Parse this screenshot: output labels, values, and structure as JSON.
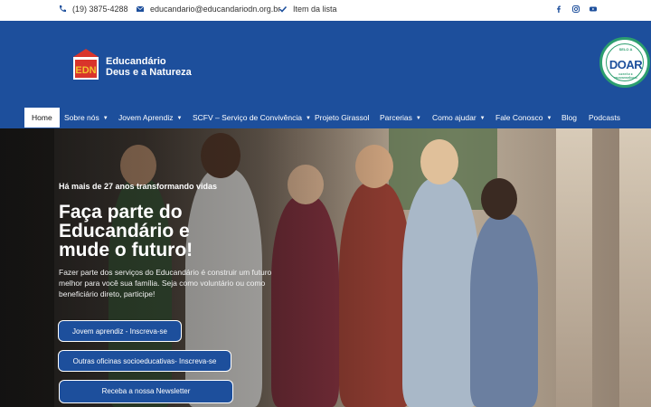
{
  "topbar": {
    "phone": "(19) 3875-4288",
    "email": "educandario@educandariodn.org.br",
    "list_link": "Item da lista",
    "social": [
      "facebook-icon",
      "instagram-icon",
      "youtube-icon"
    ]
  },
  "header": {
    "logo_line1": "Educandário",
    "logo_line2": "Deus e a Natureza",
    "seal_top": "SELO A",
    "seal_word": "DOAR",
    "seal_bottom": "GESTÃO E TRANSPARÊNCIA"
  },
  "nav": {
    "items": [
      {
        "label": "Home",
        "dropdown": false
      },
      {
        "label": "Sobre nós",
        "dropdown": true
      },
      {
        "label": "Jovem Aprendiz",
        "dropdown": true
      },
      {
        "label": "SCFV – Serviço de Convivência",
        "dropdown": true
      },
      {
        "label": "Projeto Girassol",
        "dropdown": false
      },
      {
        "label": "Parcerias",
        "dropdown": true
      },
      {
        "label": "Como ajudar",
        "dropdown": true
      },
      {
        "label": "Fale Conosco",
        "dropdown": true
      },
      {
        "label": "Blog",
        "dropdown": false
      },
      {
        "label": "Podcasts",
        "dropdown": false
      }
    ]
  },
  "hero": {
    "eyebrow": "Há mais de 27 anos transformando vidas",
    "headline_line1": "Faça parte do",
    "headline_line2": "Educandário e",
    "headline_line3": "mude o futuro!",
    "lead": "Fazer parte dos serviços do Educandário é construir um futuro melhor para você sua família. Seja como voluntário ou como beneficiário direto, participe!",
    "buttons": [
      "Jovem aprendiz - Inscreva-se",
      "Outras oficinas socioeducativas- Inscreva-se",
      "Receba a nossa Newsletter"
    ]
  },
  "colors": {
    "brand_blue": "#1d4f9c",
    "seal_green": "#2c9e6f"
  }
}
